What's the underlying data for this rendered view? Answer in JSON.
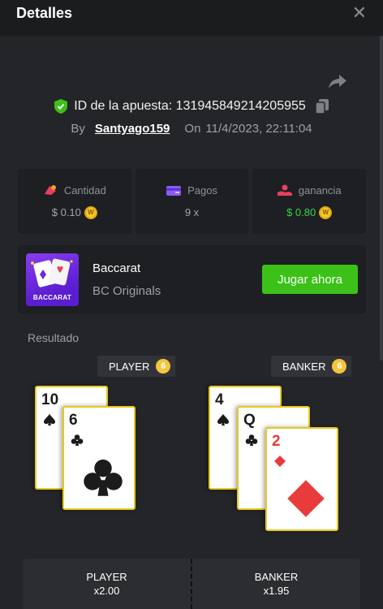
{
  "header": {
    "title": "Detalles",
    "close_icon": "close-icon"
  },
  "bet": {
    "id_label": "ID de la apuesta: 131945849214205955",
    "by": "By",
    "user": "Santyago159",
    "on": "On",
    "date": "11/4/2023, 22:11:04"
  },
  "stats": {
    "amount_label": "Cantidad",
    "amount_value": "$ 0.10",
    "payout_label": "Pagos",
    "payout_value": "9 x",
    "profit_label": "ganancia",
    "profit_value": "$ 0.80"
  },
  "game": {
    "name": "Baccarat",
    "provider": "BC Originals",
    "thumb_label": "BACCARAT",
    "play_label": "Jugar ahora"
  },
  "result": {
    "label": "Resultado",
    "player_label": "PLAYER",
    "player_score": "6",
    "banker_label": "BANKER",
    "banker_score": "6",
    "player_cards": [
      {
        "rank": "10",
        "suit": "spade"
      },
      {
        "rank": "6",
        "suit": "club"
      }
    ],
    "banker_cards": [
      {
        "rank": "4",
        "suit": "spade"
      },
      {
        "rank": "Q",
        "suit": "club"
      },
      {
        "rank": "2",
        "suit": "diamond"
      }
    ]
  },
  "bottom": {
    "player_label": "PLAYER",
    "player_odds": "x2.00",
    "banker_label": "BANKER",
    "banker_odds": "x1.95"
  },
  "colors": {
    "accent_green": "#3bc117",
    "profit_green": "#37d34a",
    "coin": "#f5c52b",
    "card_border": "#e7c820"
  }
}
